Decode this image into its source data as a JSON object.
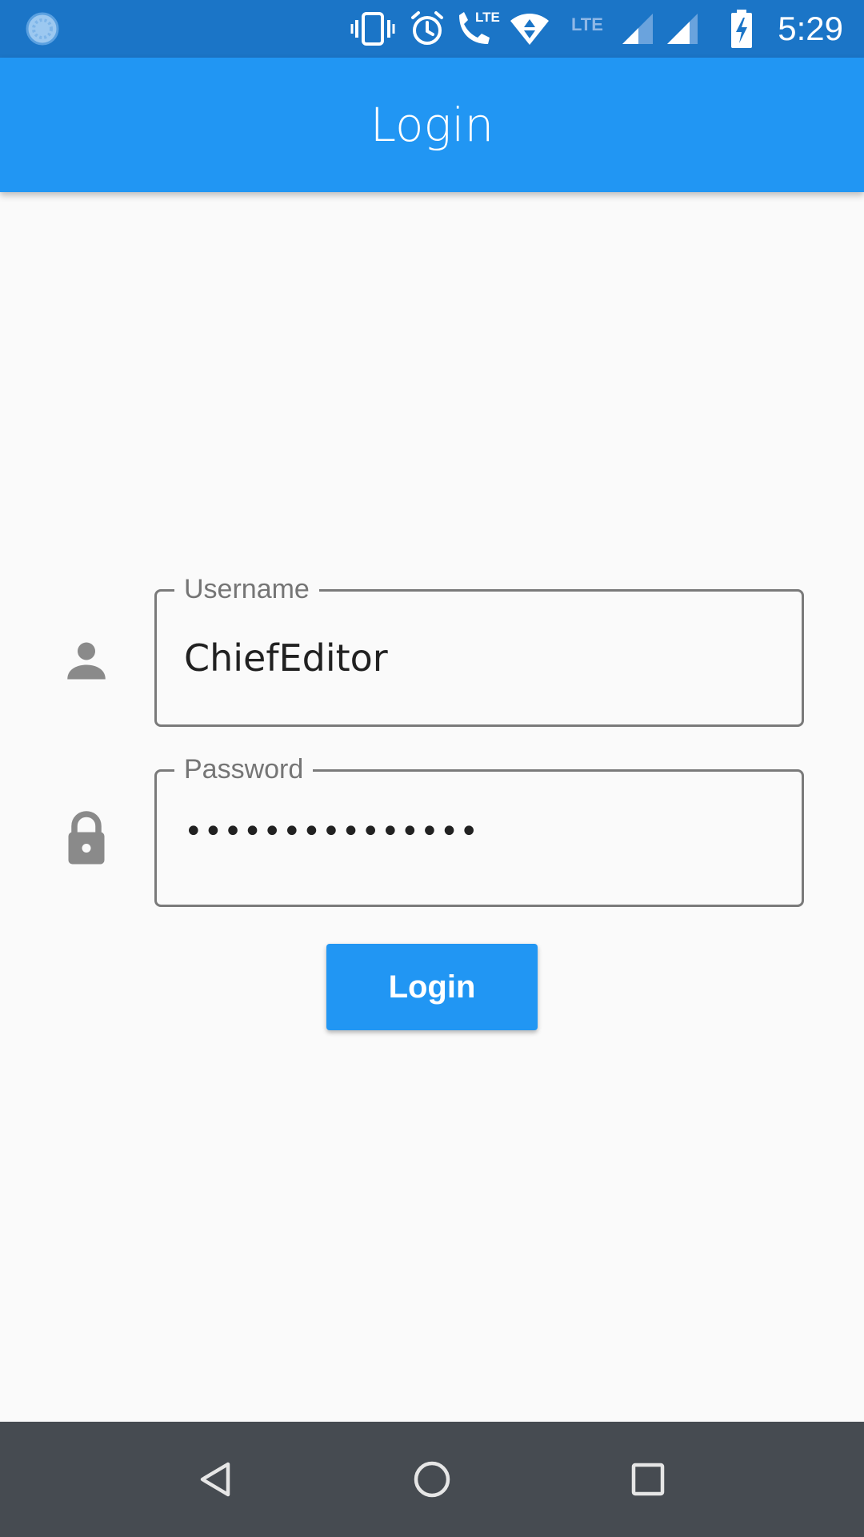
{
  "status_bar": {
    "time": "5:29",
    "network_label": "LTE",
    "icons": [
      "sync-icon",
      "vibrate-icon",
      "alarm-icon",
      "volte-call-icon",
      "wifi-icon",
      "lte-icon",
      "signal-icon",
      "signal-icon",
      "battery-charging-icon"
    ]
  },
  "app_bar": {
    "title": "Login"
  },
  "form": {
    "username": {
      "label": "Username",
      "value": "ChiefEditor",
      "icon": "person-icon"
    },
    "password": {
      "label": "Password",
      "value": "•••••••••••••••",
      "icon": "lock-icon"
    },
    "submit_label": "Login"
  },
  "nav_bar": {
    "icons": [
      "back-icon",
      "home-icon",
      "recents-icon"
    ]
  },
  "colors": {
    "status_bar": "#1b75c7",
    "app_bar": "#2196f3",
    "button": "#2196f3",
    "background": "#fafafa",
    "nav_bar": "#464b51"
  }
}
